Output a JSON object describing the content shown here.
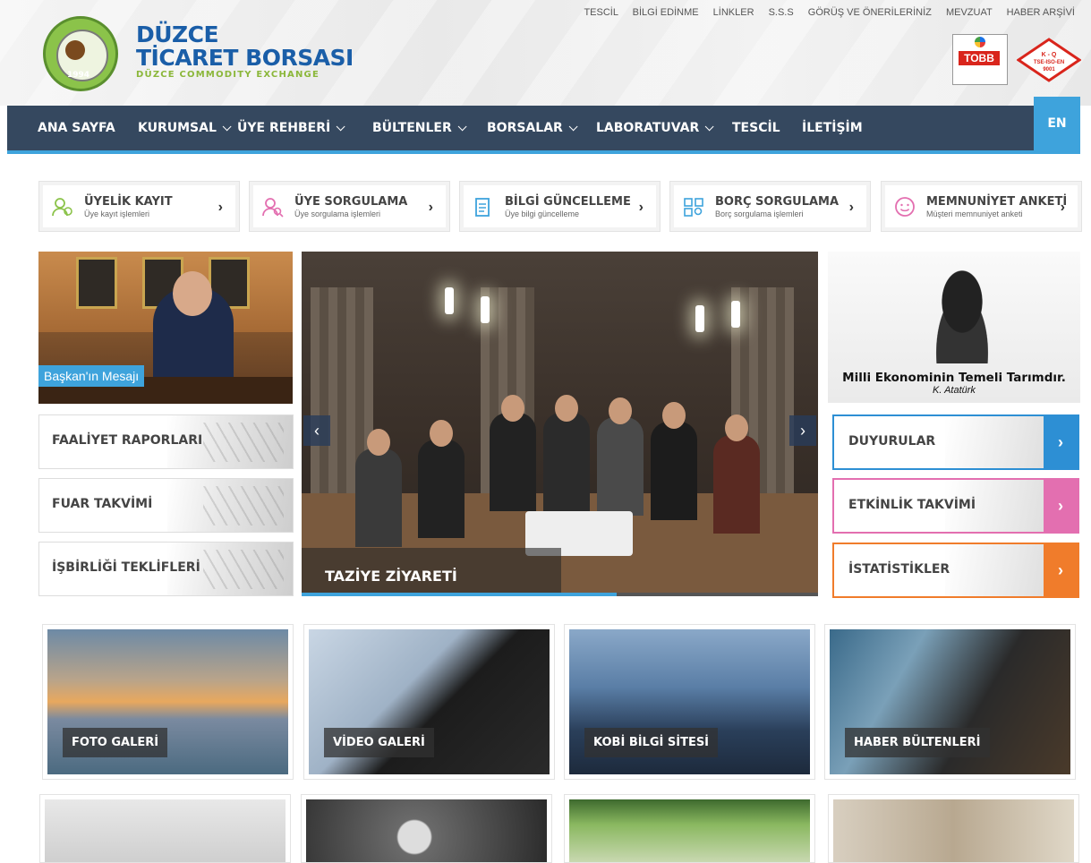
{
  "brand": {
    "title_line1": "DÜZCE",
    "title_line2": "TİCARET BORSASI",
    "subtitle": "DÜZCE COMMODITY EXCHANGE",
    "seal_year": "1994"
  },
  "top_links": [
    "TESCİL",
    "BİLGİ EDİNME",
    "LİNKLER",
    "S.S.S",
    "GÖRÜŞ VE ÖNERİLERİNİZ",
    "MEVZUAT",
    "HABER ARŞİVİ"
  ],
  "partner_logos": {
    "tobb": "TOBB",
    "tse": "K - Q\nTSE-ISO-EN\n9001"
  },
  "nav": {
    "items": [
      {
        "label": "ANA SAYFA",
        "dropdown": false
      },
      {
        "label": "KURUMSAL",
        "dropdown": true
      },
      {
        "label": "ÜYE REHBERİ",
        "dropdown": true
      },
      {
        "label": "BÜLTENLER",
        "dropdown": true
      },
      {
        "label": "BORSALAR",
        "dropdown": true
      },
      {
        "label": "LABORATUVAR",
        "dropdown": true
      },
      {
        "label": "TESCİL",
        "dropdown": false
      },
      {
        "label": "İLETİŞİM",
        "dropdown": false
      }
    ],
    "lang": "EN"
  },
  "quick_links": [
    {
      "title": "ÜYELİK KAYIT",
      "sub": "Üye kayıt işlemleri",
      "icon": "user-add-icon"
    },
    {
      "title": "ÜYE SORGULAMA",
      "sub": "Üye sorgulama işlemleri",
      "icon": "user-search-icon"
    },
    {
      "title": "BİLGİ GÜNCELLEME",
      "sub": "Üye bilgi güncelleme",
      "icon": "clipboard-icon"
    },
    {
      "title": "BORÇ SORGULAMA",
      "sub": "Borç sorgulama işlemleri",
      "icon": "debt-search-icon"
    },
    {
      "title": "MEMNUNİYET ANKETİ",
      "sub": "Müşteri memnuniyet anketi",
      "icon": "smile-icon"
    }
  ],
  "president": {
    "label": "Başkan'ın Mesajı"
  },
  "left_boxes": [
    "FAALİYET RAPORLARI",
    "FUAR TAKVİMİ",
    "İŞBİRLİĞİ TEKLİFLERİ"
  ],
  "slider": {
    "caption": "TAZİYE ZİYARETİ",
    "progress": 0.61,
    "prev": "‹",
    "next": "›"
  },
  "ataturk": {
    "quote": "Milli Ekonominin Temeli Tarımdır.",
    "author": "K. Atatürk"
  },
  "right_boxes": [
    {
      "label": "DUYURULAR",
      "color": "#2d8fd4"
    },
    {
      "label": "ETKİNLİK TAKVİMİ",
      "color": "#e36fb0"
    },
    {
      "label": "İSTATİSTİKLER",
      "color": "#f07c2b"
    }
  ],
  "tiles": [
    "FOTO GALERİ",
    "VİDEO GALERİ",
    "KOBİ BİLGİ SİTESİ",
    "HABER BÜLTENLERİ"
  ],
  "colors": {
    "nav_bg": "#35485f",
    "accent": "#3ea3dc"
  }
}
